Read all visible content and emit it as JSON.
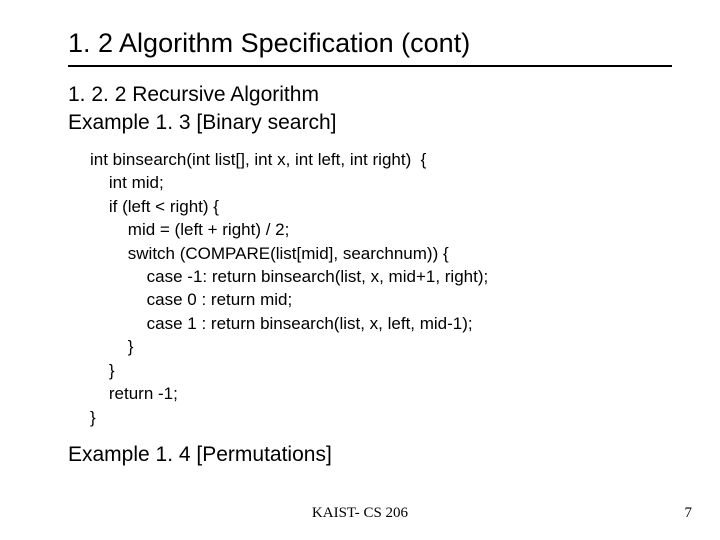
{
  "title": "1. 2 Algorithm Specification (cont)",
  "subhead_line1": "1. 2. 2 Recursive Algorithm",
  "subhead_line2": "Example 1. 3 [Binary search]",
  "code": "int binsearch(int list[], int x, int left, int right)  {\n    int mid;\n    if (left < right) {\n        mid = (left + right) / 2;\n        switch (COMPARE(list[mid], searchnum)) {\n            case -1: return binsearch(list, x, mid+1, right);\n            case 0 : return mid;\n            case 1 : return binsearch(list, x, left, mid-1);\n        }\n    }\n    return -1;\n}",
  "example2": "Example 1. 4 [Permutations]",
  "footer_center": "KAIST- CS 206",
  "footer_right": "7"
}
